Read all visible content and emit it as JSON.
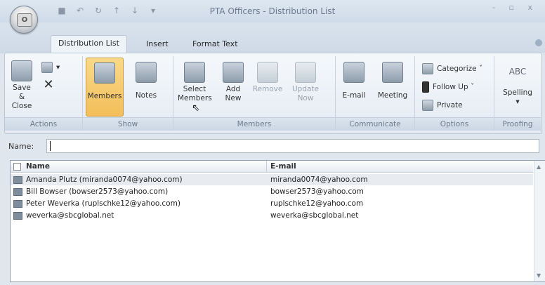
{
  "window": {
    "title": "PTA Officers - Distribution List"
  },
  "quick_access": [
    {
      "icon": "save-icon",
      "glyph": "■"
    },
    {
      "icon": "undo-icon",
      "glyph": "↶"
    },
    {
      "icon": "redo-icon",
      "glyph": "↻"
    },
    {
      "icon": "up-arrow-icon",
      "glyph": "↑"
    },
    {
      "icon": "down-arrow-icon",
      "glyph": "↓"
    },
    {
      "icon": "customize-icon",
      "glyph": "▾"
    }
  ],
  "tabs": [
    {
      "label": "Distribution List",
      "active": true
    },
    {
      "label": "Insert",
      "active": false
    },
    {
      "label": "Format Text",
      "active": false
    }
  ],
  "ribbon": {
    "actions": {
      "label": "Actions",
      "save_close": "Save &\nClose",
      "delete_icon": "✕"
    },
    "show": {
      "label": "Show",
      "members": "Members",
      "notes": "Notes"
    },
    "members": {
      "label": "Members",
      "select_members": "Select\nMembers",
      "add_new": "Add\nNew",
      "remove": "Remove",
      "update_now": "Update\nNow"
    },
    "communicate": {
      "label": "Communicate",
      "email": "E-mail",
      "meeting": "Meeting"
    },
    "options": {
      "label": "Options",
      "categorize": "Categorize ˇ",
      "follow_up": "Follow Up ˇ",
      "private": "Private"
    },
    "proofing": {
      "label": "Proofing",
      "spelling": "Spelling"
    }
  },
  "name_field": {
    "label": "Name:",
    "value": ""
  },
  "list": {
    "columns": [
      "Name",
      "E-mail"
    ],
    "rows": [
      {
        "name": "Amanda Plutz (miranda0074@yahoo.com)",
        "email": "miranda0074@yahoo.com",
        "selected": true
      },
      {
        "name": "Bill Bowser (bowser2573@yahoo.com)",
        "email": "bowser2573@yahoo.com",
        "selected": false
      },
      {
        "name": "Peter Weverka (ruplschke12@yahoo.com)",
        "email": "ruplschke12@yahoo.com",
        "selected": false
      },
      {
        "name": "weverka@sbcglobal.net",
        "email": "weverka@sbcglobal.net",
        "selected": false
      }
    ]
  }
}
